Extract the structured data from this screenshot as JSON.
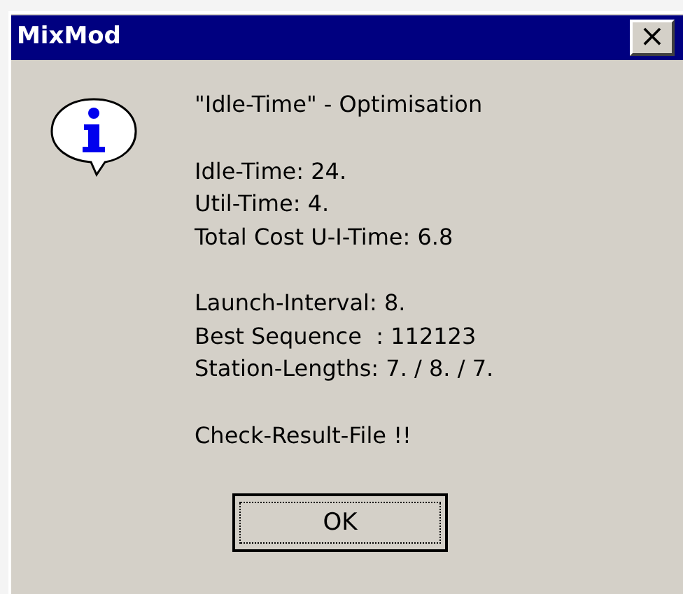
{
  "window": {
    "title": "MixMod",
    "close_label": "×"
  },
  "message_groups": [
    [
      "\"Idle-Time\" - Optimisation"
    ],
    [
      "Idle-Time: 24.",
      "Util-Time: 4.",
      "Total Cost U-I-Time: 6.8"
    ],
    [
      "Launch-Interval: 8.",
      "Best Sequence  : 112123",
      "Station-Lengths: 7. / 8. / 7."
    ],
    [
      "Check-Result-File !!"
    ]
  ],
  "buttons": [
    {
      "label": "OK",
      "focused": true
    }
  ]
}
